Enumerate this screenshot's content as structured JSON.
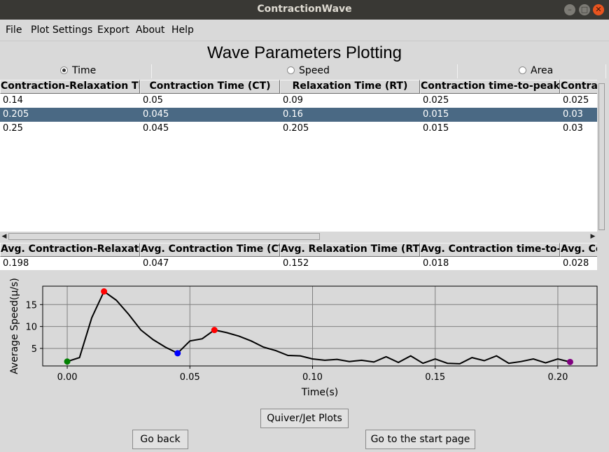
{
  "window": {
    "title": "ContractionWave"
  },
  "menu": [
    "File",
    "Plot Settings",
    "Export",
    "About",
    "Help"
  ],
  "heading": "Wave Parameters Plotting",
  "radios": [
    {
      "label": "Time",
      "selected": true
    },
    {
      "label": "Speed",
      "selected": false
    },
    {
      "label": "Area",
      "selected": false
    }
  ],
  "table": {
    "headers": [
      "Contraction-Relaxation Tir",
      "Contraction Time (CT)",
      "Relaxation Time (RT)",
      "Contraction time-to-peak (",
      "Contrac"
    ],
    "rows": [
      [
        "0.14",
        "0.05",
        "0.09",
        "0.025",
        "0.025"
      ],
      [
        "0.205",
        "0.045",
        "0.16",
        "0.015",
        "0.03"
      ],
      [
        "0.25",
        "0.045",
        "0.205",
        "0.015",
        "0.03"
      ]
    ],
    "selected_row": 1
  },
  "avg_table": {
    "headers": [
      "Avg. Contraction-Relaxatio",
      "Avg. Contraction Time (CT",
      "Avg. Relaxation Time (RT)",
      "Avg. Contraction time-to-p",
      "Avg. Con"
    ],
    "values": [
      "0.198",
      "0.047",
      "0.152",
      "0.018",
      "0.028"
    ]
  },
  "chart_data": {
    "type": "line",
    "xlabel": "Time(s)",
    "ylabel": "Average Speed(μ/s)",
    "xlim": [
      -0.01,
      0.216
    ],
    "ylim": [
      1.0,
      19.2
    ],
    "xticks": [
      "0.00",
      "0.05",
      "0.10",
      "0.15",
      "0.20"
    ],
    "xtick_values": [
      0.0,
      0.05,
      0.1,
      0.15,
      0.2
    ],
    "yticks": [
      "5",
      "10",
      "15"
    ],
    "ytick_values": [
      5,
      10,
      15
    ],
    "grid": true,
    "x": [
      0.0,
      0.005,
      0.01,
      0.015,
      0.02,
      0.025,
      0.03,
      0.035,
      0.04,
      0.045,
      0.05,
      0.055,
      0.06,
      0.065,
      0.07,
      0.075,
      0.08,
      0.085,
      0.09,
      0.095,
      0.1,
      0.105,
      0.11,
      0.115,
      0.12,
      0.125,
      0.13,
      0.135,
      0.14,
      0.145,
      0.15,
      0.155,
      0.16,
      0.165,
      0.17,
      0.175,
      0.18,
      0.185,
      0.19,
      0.195,
      0.2,
      0.205
    ],
    "y": [
      2.0,
      2.9,
      12.0,
      18.0,
      16.0,
      12.8,
      9.2,
      7.0,
      5.3,
      3.9,
      6.7,
      7.2,
      9.2,
      8.6,
      7.8,
      6.7,
      5.3,
      4.5,
      3.4,
      3.3,
      2.6,
      2.3,
      2.5,
      2.0,
      2.3,
      1.9,
      3.1,
      1.8,
      3.3,
      1.6,
      2.6,
      1.6,
      1.5,
      2.9,
      2.2,
      3.3,
      1.6,
      2.0,
      2.6,
      1.7,
      2.6,
      1.9
    ],
    "markers": [
      {
        "x": 0.0,
        "y": 2.0,
        "color": "#008000"
      },
      {
        "x": 0.015,
        "y": 18.0,
        "color": "#ff0000"
      },
      {
        "x": 0.045,
        "y": 3.9,
        "color": "#0000ff"
      },
      {
        "x": 0.06,
        "y": 9.2,
        "color": "#ff0000"
      },
      {
        "x": 0.205,
        "y": 1.9,
        "color": "#800080"
      }
    ]
  },
  "buttons": {
    "quiver": "Quiver/Jet Plots",
    "back": "Go back",
    "start": "Go to the start page"
  },
  "icons": {
    "minimize": "minimize-icon",
    "maximize": "maximize-icon",
    "close": "close-icon"
  }
}
